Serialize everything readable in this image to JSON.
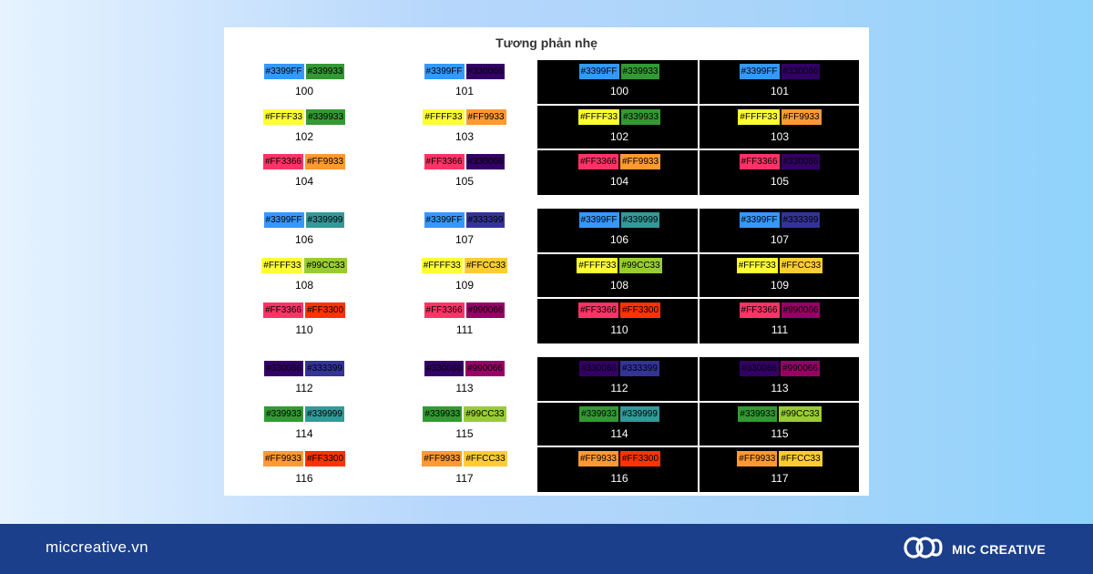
{
  "title": "Tương phản nhẹ",
  "groups": [
    [
      {
        "num": "100",
        "a": "#3399FF",
        "b": "#339933"
      },
      {
        "num": "101",
        "a": "#3399FF",
        "b": "#330066"
      },
      {
        "num": "102",
        "a": "#FFFF33",
        "b": "#339933"
      },
      {
        "num": "103",
        "a": "#FFFF33",
        "b": "#FF9933"
      },
      {
        "num": "104",
        "a": "#FF3366",
        "b": "#FF9933"
      },
      {
        "num": "105",
        "a": "#FF3366",
        "b": "#330066"
      }
    ],
    [
      {
        "num": "106",
        "a": "#3399FF",
        "b": "#339999"
      },
      {
        "num": "107",
        "a": "#3399FF",
        "b": "#333399"
      },
      {
        "num": "108",
        "a": "#FFFF33",
        "b": "#99CC33"
      },
      {
        "num": "109",
        "a": "#FFFF33",
        "b": "#FFCC33"
      },
      {
        "num": "110",
        "a": "#FF3366",
        "b": "#FF3300"
      },
      {
        "num": "111",
        "a": "#FF3366",
        "b": "#990066"
      }
    ],
    [
      {
        "num": "112",
        "a": "#330066",
        "b": "#333399"
      },
      {
        "num": "113",
        "a": "#330066",
        "b": "#990066"
      },
      {
        "num": "114",
        "a": "#339933",
        "b": "#339999"
      },
      {
        "num": "115",
        "a": "#339933",
        "b": "#99CC33"
      },
      {
        "num": "116",
        "a": "#FF9933",
        "b": "#FF3300"
      },
      {
        "num": "117",
        "a": "#FF9933",
        "b": "#FFCC33"
      }
    ]
  ],
  "footer": {
    "site": "miccreative.vn",
    "brand": "MIC CREATIVE",
    "logo_icon": "mic-creative-logo-icon"
  },
  "colors": {
    "footer_bg": "#1b3f8a",
    "dark_panel": "#000000",
    "light_panel": "#ffffff"
  }
}
